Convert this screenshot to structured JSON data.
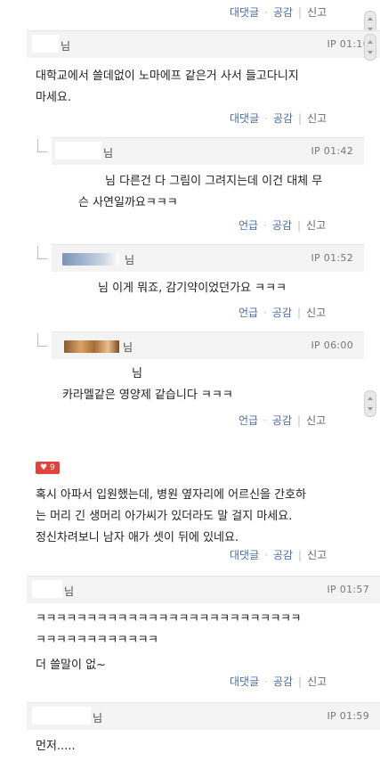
{
  "top_actions": {
    "reply": "대댓글",
    "like": "공감",
    "report": "신고"
  },
  "comments": [
    {
      "name": "님",
      "ip": "IP 01:10",
      "lines": [
        "대학교에서 쓸데없이 노마에프 같은거 사서 들고다니지",
        "마세요."
      ],
      "actions": {
        "reply": "대댓글",
        "like": "공감",
        "report": "신고"
      }
    },
    {
      "name": "님",
      "ip": "IP 01:42",
      "lines": [
        "님 다른건 다 그림이 그려지는데 이건 대체 무",
        "슨 사연일까요ㅋㅋㅋ"
      ],
      "actions": {
        "reply": "언급",
        "like": "공감",
        "report": "신고"
      }
    },
    {
      "name": "님",
      "ip": "IP 01:52",
      "lines": [
        "님 이게 뭐죠, 감기약이었던가요 ㅋㅋㅋ"
      ],
      "actions": {
        "reply": "언급",
        "like": "공감",
        "report": "신고"
      }
    },
    {
      "name": "님",
      "ip": "IP 06:00",
      "lines": [
        "님",
        "카라멜같은 영양제 같습니다 ㅋㅋㅋ"
      ],
      "actions": {
        "reply": "언급",
        "like": "공감",
        "report": "신고"
      }
    },
    {
      "badge": "9",
      "lines": [
        "혹시 아파서 입원했는데, 병원 옆자리에 어르신을 간호하",
        "는 머리 긴 생머리 아가씨가 있더라도 말 걸지 마세요.",
        "정신차려보니 남자 애가 셋이 뒤에 있네요."
      ],
      "actions": {
        "reply": "대댓글",
        "like": "공감",
        "report": "신고"
      }
    },
    {
      "name": "님",
      "ip": "IP 01:57",
      "lines": [
        "ㅋㅋㅋㅋㅋㅋㅋㅋㅋㅋㅋㅋㅋㅋㅋㅋㅋㅋㅋㅋㅋㅋㅋㅋㅋㅋ",
        "ㅋㅋㅋㅋㅋㅋㅋㅋㅋㅋㅋㅋ",
        "더 쓸말이 없~"
      ],
      "actions": {
        "reply": "대댓글",
        "like": "공감",
        "report": "신고"
      }
    },
    {
      "name": "님",
      "ip": "IP 01:59",
      "lines": [
        "먼저....."
      ]
    }
  ]
}
